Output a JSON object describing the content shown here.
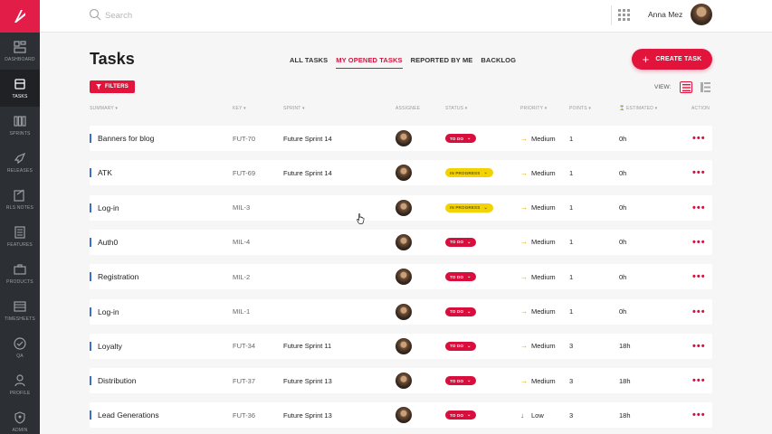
{
  "sidebar": {
    "items": [
      {
        "label": "DASHBOARD",
        "icon": "dashboard-icon"
      },
      {
        "label": "TASKS",
        "icon": "tasks-icon",
        "active": true
      },
      {
        "label": "SPRINTS",
        "icon": "sprints-icon"
      },
      {
        "label": "RELEASES",
        "icon": "rocket-icon"
      },
      {
        "label": "RLS NOTES",
        "icon": "notes-icon"
      },
      {
        "label": "FEATURES",
        "icon": "features-icon"
      },
      {
        "label": "PRODUCTS",
        "icon": "briefcase-icon"
      },
      {
        "label": "TIMESHEETS",
        "icon": "timesheet-icon"
      },
      {
        "label": "QA",
        "icon": "check-circle-icon"
      },
      {
        "label": "PROFILE",
        "icon": "user-icon"
      },
      {
        "label": "ADMIN",
        "icon": "admin-icon"
      }
    ]
  },
  "topbar": {
    "search_placeholder": "Search",
    "user_name": "Anna Mez"
  },
  "page": {
    "title": "Tasks",
    "tabs": [
      "ALL TASKS",
      "MY OPENED TASKS",
      "REPORTED BY ME",
      "BACKLOG"
    ],
    "active_tab": "MY OPENED TASKS",
    "create_label": "CREATE TASK",
    "filters_label": "FILTERS",
    "view_label": "VIEW:"
  },
  "columns": {
    "summary": "SUMMARY ▾",
    "key": "KEY ▾",
    "sprint": "SPRINT ▾",
    "assignee": "ASSIGNEE",
    "status": "STATUS ▾",
    "priority": "PRIORITY ▾",
    "points": "POINTS ▾",
    "estimated": "⌛ ESTIMATED ▾",
    "action": "ACTION"
  },
  "rows": [
    {
      "summary": "Banners for blog",
      "key": "FUT-70",
      "sprint": "Future Sprint 14",
      "status": "TO DO",
      "status_type": "todo",
      "priority": "Medium",
      "priority_icon": "→",
      "points": "1",
      "estimated": "0h"
    },
    {
      "summary": "ATK",
      "key": "FUT-69",
      "sprint": "Future Sprint 14",
      "status": "IN PROGRESS",
      "status_type": "prog",
      "priority": "Medium",
      "priority_icon": "→",
      "points": "1",
      "estimated": "0h"
    },
    {
      "summary": "Log-in",
      "key": "MIL-3",
      "sprint": "",
      "status": "IN PROGRESS",
      "status_type": "prog",
      "priority": "Medium",
      "priority_icon": "→",
      "points": "1",
      "estimated": "0h"
    },
    {
      "summary": "Auth0",
      "key": "MIL-4",
      "sprint": "",
      "status": "TO DO",
      "status_type": "todo",
      "priority": "Medium",
      "priority_icon": "→",
      "points": "1",
      "estimated": "0h"
    },
    {
      "summary": "Registration",
      "key": "MIL-2",
      "sprint": "",
      "status": "TO DO",
      "status_type": "todo",
      "priority": "Medium",
      "priority_icon": "→",
      "points": "1",
      "estimated": "0h"
    },
    {
      "summary": "Log-in",
      "key": "MIL-1",
      "sprint": "",
      "status": "TO DO",
      "status_type": "todo",
      "priority": "Medium",
      "priority_icon": "→",
      "points": "1",
      "estimated": "0h"
    },
    {
      "summary": "Loyalty",
      "key": "FUT-34",
      "sprint": "Future Sprint 11",
      "status": "TO DO",
      "status_type": "todo",
      "priority": "Medium",
      "priority_icon": "→",
      "points": "3",
      "estimated": "18h"
    },
    {
      "summary": "Distribution",
      "key": "FUT-37",
      "sprint": "Future Sprint 13",
      "status": "TO DO",
      "status_type": "todo",
      "priority": "Medium",
      "priority_icon": "→",
      "points": "3",
      "estimated": "18h"
    },
    {
      "summary": "Lead Generations",
      "key": "FUT-36",
      "sprint": "Future Sprint 13",
      "status": "TO DO",
      "status_type": "todo",
      "priority": "Low",
      "priority_icon": "↓",
      "points": "3",
      "estimated": "18h"
    }
  ],
  "colors": {
    "accent": "#e3143c",
    "sidebar": "#2c2f33",
    "in_progress": "#f2d300",
    "priority_medium": "#e8a600",
    "row_bar": "#3b6fc9"
  }
}
